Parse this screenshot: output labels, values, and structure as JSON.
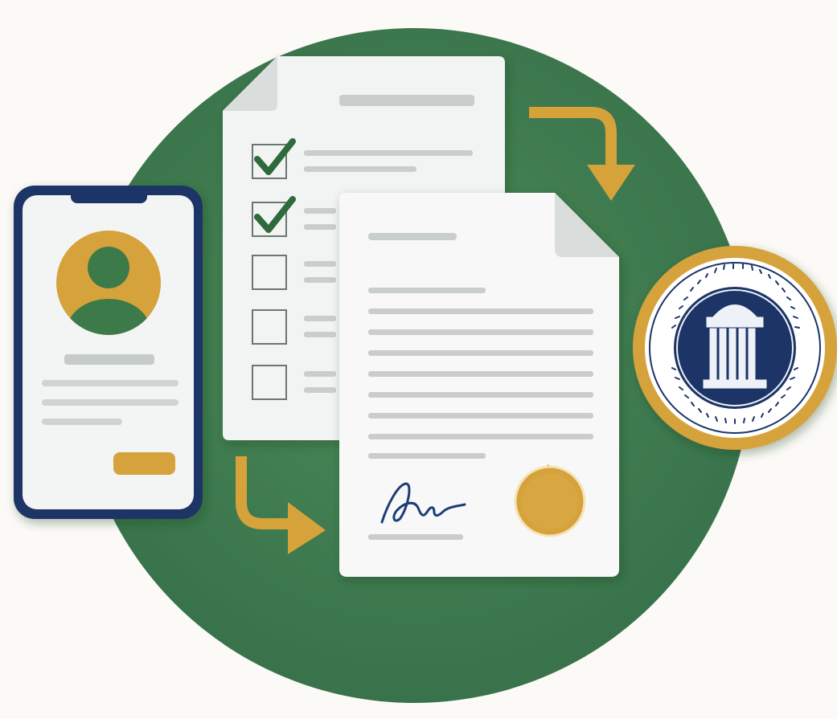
{
  "illustration": {
    "colors": {
      "background": "#fbfaf6",
      "circle_green": "#3e7a4a",
      "navy": "#1d3566",
      "gold": "#d6a23a",
      "paper": "#f7f8f7",
      "paper_shade": "#e6e9e8",
      "placeholder_line": "#c9cdcc",
      "check_green": "#2f6b3a"
    },
    "icons": [
      "phone-icon",
      "user-avatar-icon",
      "checklist-document-icon",
      "checkmark-icon",
      "certificate-document-icon",
      "signature-icon",
      "wax-seal-icon",
      "institution-seal-icon",
      "building-icon",
      "arrow-icon"
    ],
    "checklist": {
      "items": [
        {
          "checked": true
        },
        {
          "checked": true
        },
        {
          "checked": false
        },
        {
          "checked": false
        },
        {
          "checked": false
        }
      ]
    }
  }
}
